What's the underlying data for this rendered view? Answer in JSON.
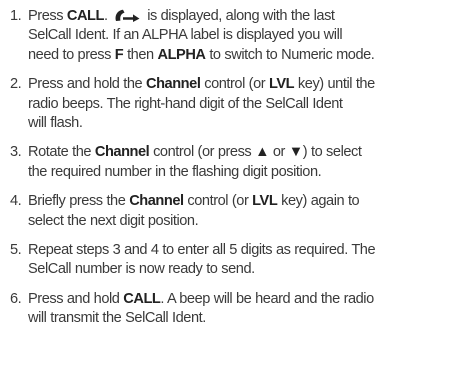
{
  "steps": [
    {
      "number": "1.",
      "lines": [
        [
          {
            "t": "Press "
          },
          {
            "b": "CALL"
          },
          {
            "t": ". "
          },
          {
            "icon": "call-arrow-icon"
          },
          {
            "t": " is displayed, along with the last"
          }
        ],
        [
          {
            "t": "SelCall Ident. If an ALPHA label is displayed you will"
          }
        ],
        [
          {
            "t": "need to press "
          },
          {
            "b": "F"
          },
          {
            "t": " then "
          },
          {
            "b": "ALPHA"
          },
          {
            "t": " to switch to Numeric mode."
          }
        ]
      ]
    },
    {
      "number": "2.",
      "lines": [
        [
          {
            "t": "Press and hold the "
          },
          {
            "b": "Channel"
          },
          {
            "t": " control (or "
          },
          {
            "b": "LVL"
          },
          {
            "t": " key) until the"
          }
        ],
        [
          {
            "t": "radio beeps. The right-hand digit of the SelCall Ident"
          }
        ],
        [
          {
            "t": "will flash."
          }
        ]
      ]
    },
    {
      "number": "3.",
      "lines": [
        [
          {
            "t": "Rotate the "
          },
          {
            "b": "Channel"
          },
          {
            "t": " control (or press "
          },
          {
            "b": "▲"
          },
          {
            "t": " or "
          },
          {
            "b": "▼"
          },
          {
            "t": ") to select"
          }
        ],
        [
          {
            "t": "the required number in the flashing digit position."
          }
        ]
      ]
    },
    {
      "number": "4.",
      "lines": [
        [
          {
            "t": "Briefly press the "
          },
          {
            "b": "Channel"
          },
          {
            "t": " control (or "
          },
          {
            "b": "LVL"
          },
          {
            "t": " key) again to"
          }
        ],
        [
          {
            "t": "select the next digit position."
          }
        ]
      ]
    },
    {
      "number": "5.",
      "lines": [
        [
          {
            "t": "Repeat steps 3 and 4 to enter all 5 digits as required. The"
          }
        ],
        [
          {
            "t": "SelCall number is now ready to send."
          }
        ]
      ]
    },
    {
      "number": "6.",
      "lines": [
        [
          {
            "t": "Press and hold "
          },
          {
            "b": "CALL"
          },
          {
            "t": ". A beep will be heard and the radio"
          }
        ],
        [
          {
            "t": "will transmit the SelCall Ident."
          }
        ]
      ]
    }
  ]
}
